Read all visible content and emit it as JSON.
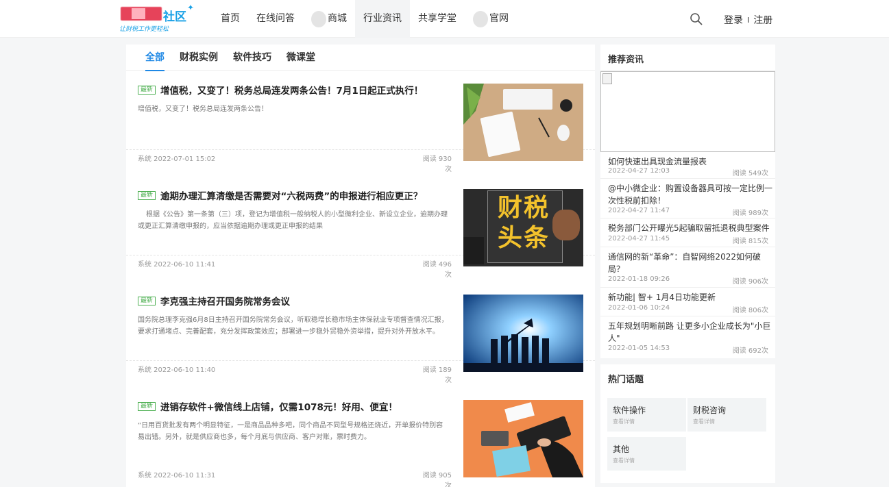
{
  "header": {
    "logo_name": "社区",
    "logo_tagline": "让财税工作更轻松",
    "nav": [
      "首页",
      "在线问答",
      "商城",
      "行业资讯",
      "共享学堂",
      "官网"
    ],
    "login": "登录",
    "separator": "I",
    "register": "注册"
  },
  "tabs": [
    "全部",
    "财税实例",
    "软件技巧",
    "微课堂"
  ],
  "articles": [
    {
      "badge": "最新",
      "title": "增值税，又变了！税务总局连发两条公告！7月1日起正式执行！",
      "summary": "增值税，又变了！税务总局连发两条公告！",
      "author_time": "系统 2022-07-01 15:02",
      "reads": "阅读 930次"
    },
    {
      "badge": "最新",
      "title": "逾期办理汇算清缴是否需要对“六税两费”的申报进行相应更正？",
      "summary": "根据《公告》第一条第（三）项，登记为增值税一般纳税人的小型微利企业、新设立企业，逾期办理或更正汇算清缴申报的，应当依据逾期办理或更正申报的结果",
      "author_time": "系统 2022-06-10 11:41",
      "reads": "阅读 496次",
      "thumb_text": "财税头条"
    },
    {
      "badge": "最新",
      "title": "李克强主持召开国务院常务会议",
      "summary": "国务院总理李克强6月8日主持召开国务院常务会议，听取稳增长稳市场主体保就业专项督查情况汇报，要求打通堵点、完善配套，充分发挥政策效应；部署进一步稳外贸稳外资举措，提升对外开放水平。",
      "author_time": "系统 2022-06-10 11:40",
      "reads": "阅读 189次"
    },
    {
      "badge": "最新",
      "title": "进销存软件+微信线上店铺，仅需1078元！好用、便宜！",
      "summary": "“日用百货批发有两个明显特征，一是商品品种多吧，同个商品不同型号规格还烧近，开单报价特别容易出错。另外，就是供应商也多，每个月底与供应商、客户对账，票时费力。",
      "author_time": "系统 2022-06-10 11:31",
      "reads": "阅读 905次"
    }
  ],
  "recommended": {
    "title": "推荐资讯",
    "items": [
      {
        "title": "如何快速出具现金流量报表",
        "date": "2022-04-27 12:03",
        "reads": "阅读 549次"
      },
      {
        "title": "@中小微企业：购置设备器具可按一定比例一次性税前扣除！",
        "date": "2022-04-27 11:47",
        "reads": "阅读 989次"
      },
      {
        "title": "税务部门公开曝光5起骗取留抵退税典型案件",
        "date": "2022-04-27 11:45",
        "reads": "阅读 815次"
      },
      {
        "title": "通信网的新“革命”：自智网络2022如何破局？",
        "date": "2022-01-18 09:26",
        "reads": "阅读 906次"
      },
      {
        "title": "新功能| 智+ 1月4日功能更新",
        "date": "2022-01-06 10:24",
        "reads": "阅读 806次"
      },
      {
        "title": "五年规划明晰前路 让更多小企业成长为\"小巨人\"",
        "date": "2022-01-05 14:53",
        "reads": "阅读 692次"
      }
    ]
  },
  "hot_topics": {
    "title": "热门话题",
    "items": [
      {
        "name": "软件操作",
        "sub": "查看详情"
      },
      {
        "name": "财税咨询",
        "sub": "查看详情"
      },
      {
        "name": "其他",
        "sub": "查看详情"
      }
    ]
  },
  "colors": {
    "accent": "#1e88e5",
    "badge": "#4caf50",
    "logo": "#1aa1e6"
  }
}
